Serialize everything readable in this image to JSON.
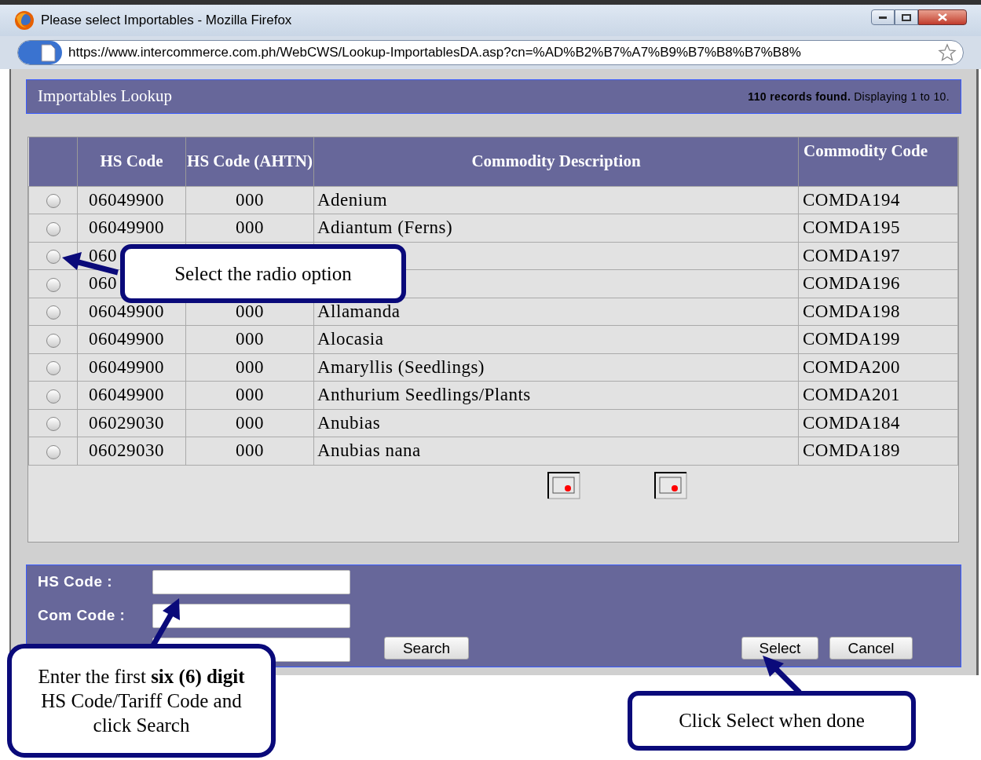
{
  "window": {
    "title": "Please select Importables - Mozilla Firefox",
    "url": "https://www.intercommerce.com.ph/WebCWS/Lookup-ImportablesDA.asp?cn=%AD%B2%B7%A7%B9%B7%B8%B7%B8%"
  },
  "header": {
    "title": "Importables Lookup",
    "records": "110 records found.",
    "displaying": "Displaying 1 to 10."
  },
  "table": {
    "columns": [
      "HS Code",
      "HS Code (AHTN)",
      "Commodity Description",
      "Commodity Code"
    ],
    "rows": [
      {
        "selected": false,
        "hs_code": "06049900",
        "ahtn": "000",
        "description": "Adenium",
        "commodity_code": "COMDA194"
      },
      {
        "selected": false,
        "hs_code": "06049900",
        "ahtn": "000",
        "description": "Adiantum (Ferns)",
        "commodity_code": "COMDA195"
      },
      {
        "selected": false,
        "hs_code": "060",
        "commodity_code": "COMDA197"
      },
      {
        "selected": false,
        "hs_code": "060",
        "commodity_code": "COMDA196"
      },
      {
        "selected": false,
        "hs_code": "06049900",
        "ahtn": "000",
        "description": "Allamanda",
        "commodity_code": "COMDA198"
      },
      {
        "selected": false,
        "hs_code": "06049900",
        "ahtn": "000",
        "description": "Alocasia",
        "commodity_code": "COMDA199"
      },
      {
        "selected": false,
        "hs_code": "06049900",
        "ahtn": "000",
        "description": "Amaryllis (Seedlings)",
        "commodity_code": "COMDA200"
      },
      {
        "selected": false,
        "hs_code": "06049900",
        "ahtn": "000",
        "description": "Anthurium Seedlings/Plants",
        "commodity_code": "COMDA201"
      },
      {
        "selected": false,
        "hs_code": "06029030",
        "ahtn": "000",
        "description": "Anubias",
        "commodity_code": "COMDA184"
      },
      {
        "selected": false,
        "hs_code": "06029030",
        "ahtn": "000",
        "description": "Anubias nana",
        "commodity_code": "COMDA189"
      }
    ]
  },
  "search_form": {
    "fields": [
      {
        "kind": "text",
        "label": "HS Code :"
      },
      {
        "kind": "text",
        "label": "Com Code :"
      },
      {
        "kind": "text"
      }
    ],
    "buttons": [
      "Search",
      "Select",
      "Cancel"
    ]
  },
  "callouts": [
    "Select the radio option",
    "Enter the first **six (6) digit** HS Code/Tariff Code and click Search",
    "Click Select when done"
  ]
}
